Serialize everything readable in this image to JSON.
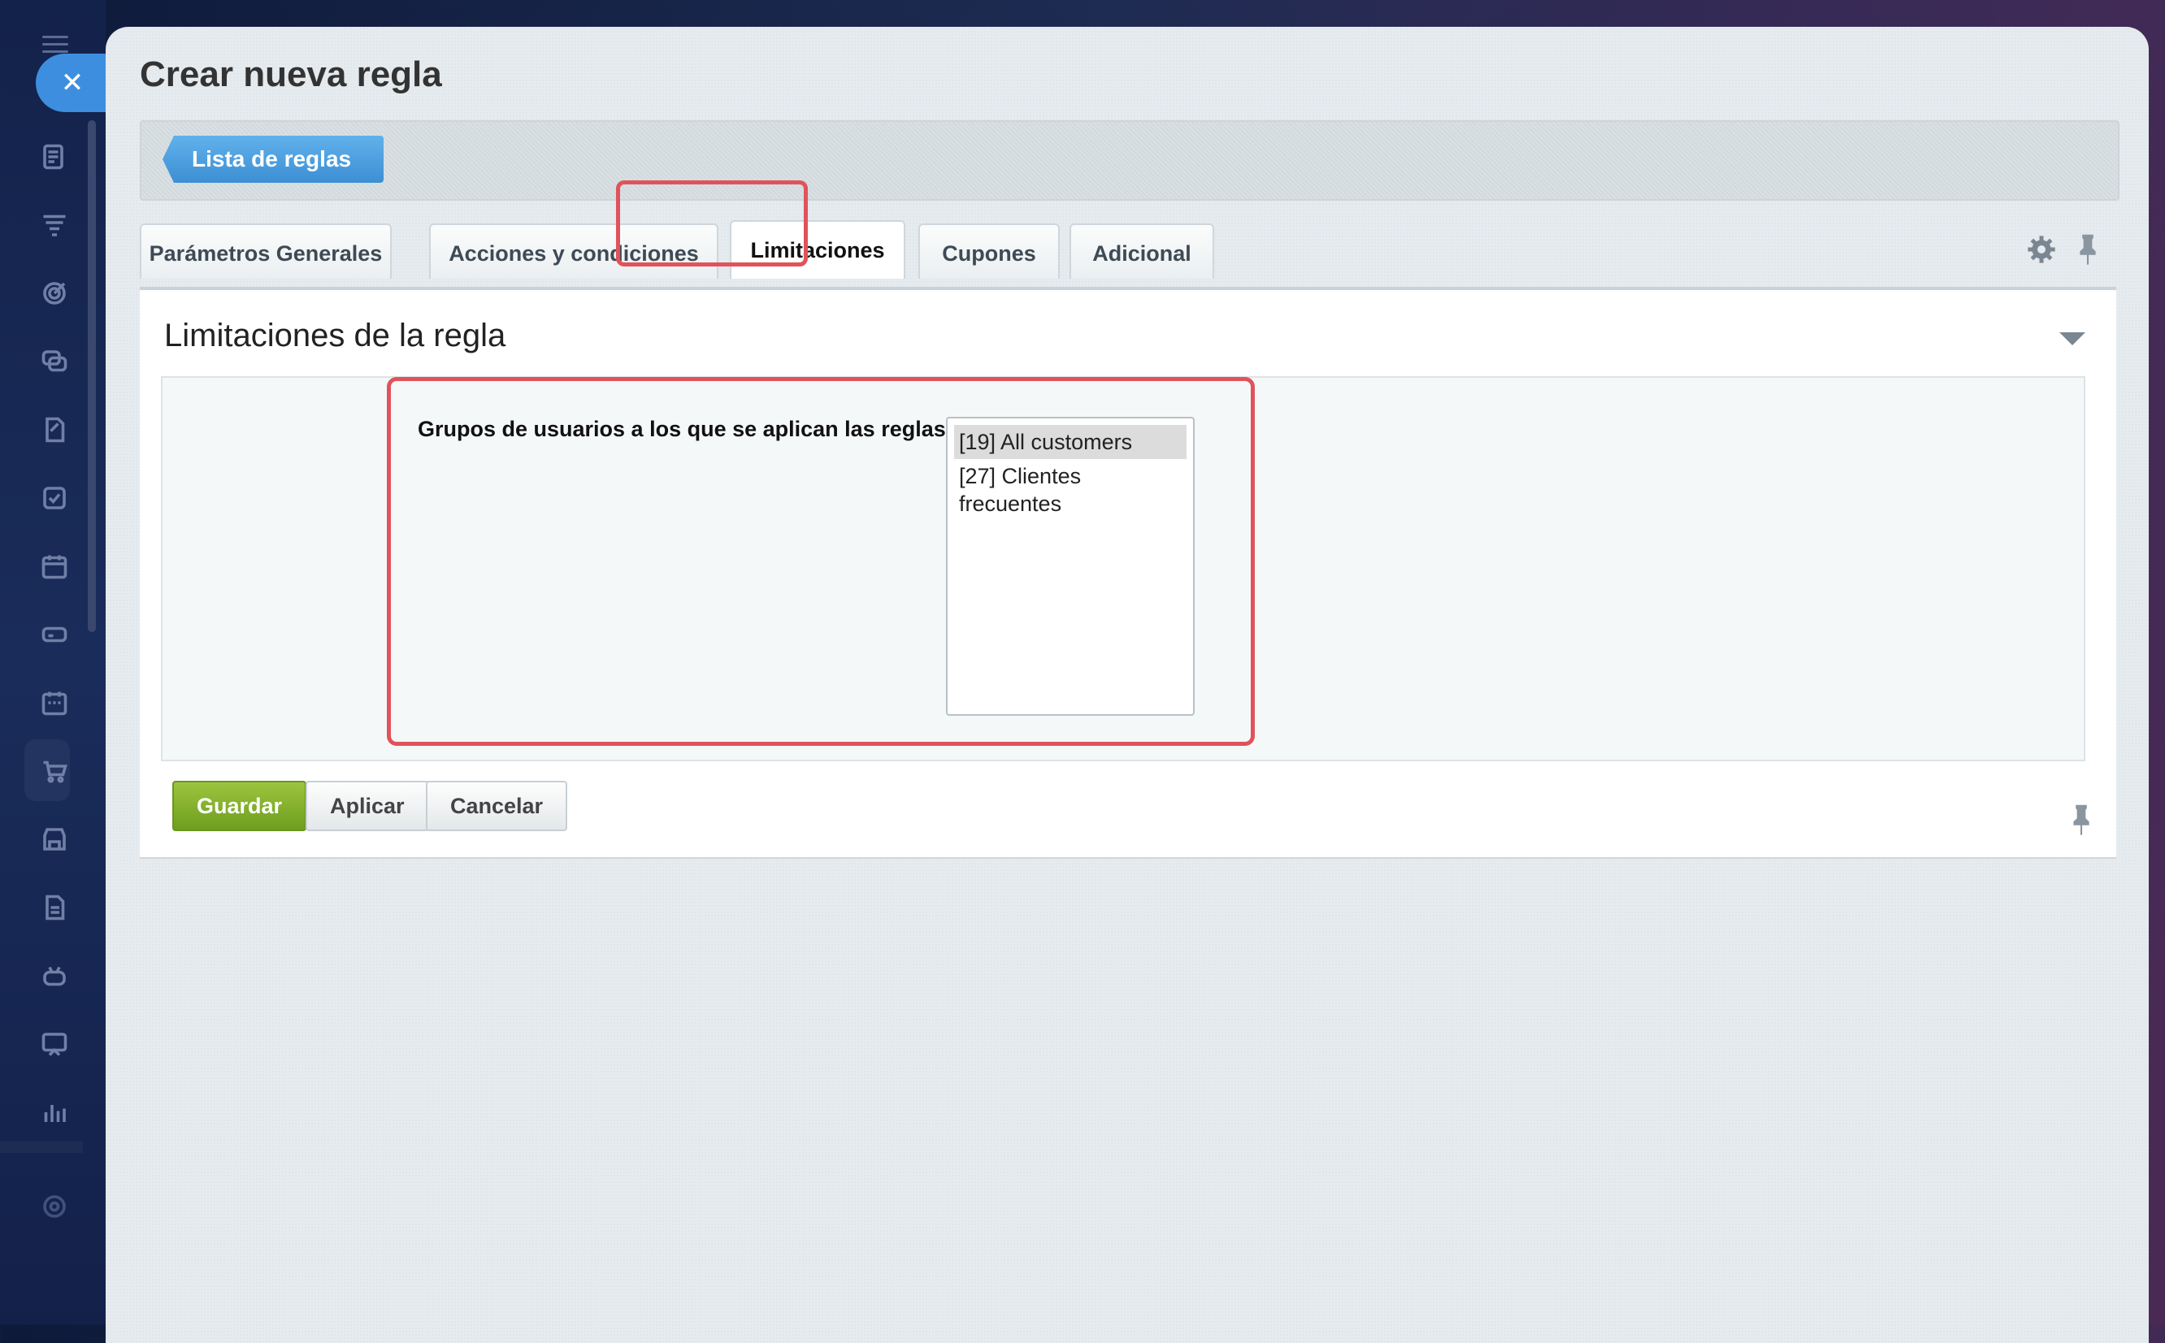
{
  "dialog": {
    "title": "Crear nueva regla"
  },
  "breadcrumb": {
    "label": "Lista de reglas"
  },
  "tabs": [
    {
      "label": "Parámetros Generales",
      "active": false
    },
    {
      "label": "Acciones y condiciones",
      "active": false
    },
    {
      "label": "Limitaciones",
      "active": true
    },
    {
      "label": "Cupones",
      "active": false
    },
    {
      "label": "Adicional",
      "active": false
    }
  ],
  "section": {
    "title": "Limitaciones de la regla"
  },
  "form": {
    "user_groups_label": "Grupos de usuarios a los que se aplican las reglas:",
    "user_groups_options": [
      "[19] All customers",
      "[27] Clientes frecuentes"
    ],
    "selected": "[19] All customers"
  },
  "actions": {
    "save": "Guardar",
    "apply": "Aplicar",
    "cancel": "Cancelar"
  },
  "colors": {
    "accent_blue": "#3e8ee0",
    "save_green": "#7fae2a",
    "highlight_red": "#e0535b"
  },
  "icons": [
    "hamburger-icon",
    "close-icon",
    "gear-icon",
    "pin-icon",
    "collapse-icon"
  ]
}
